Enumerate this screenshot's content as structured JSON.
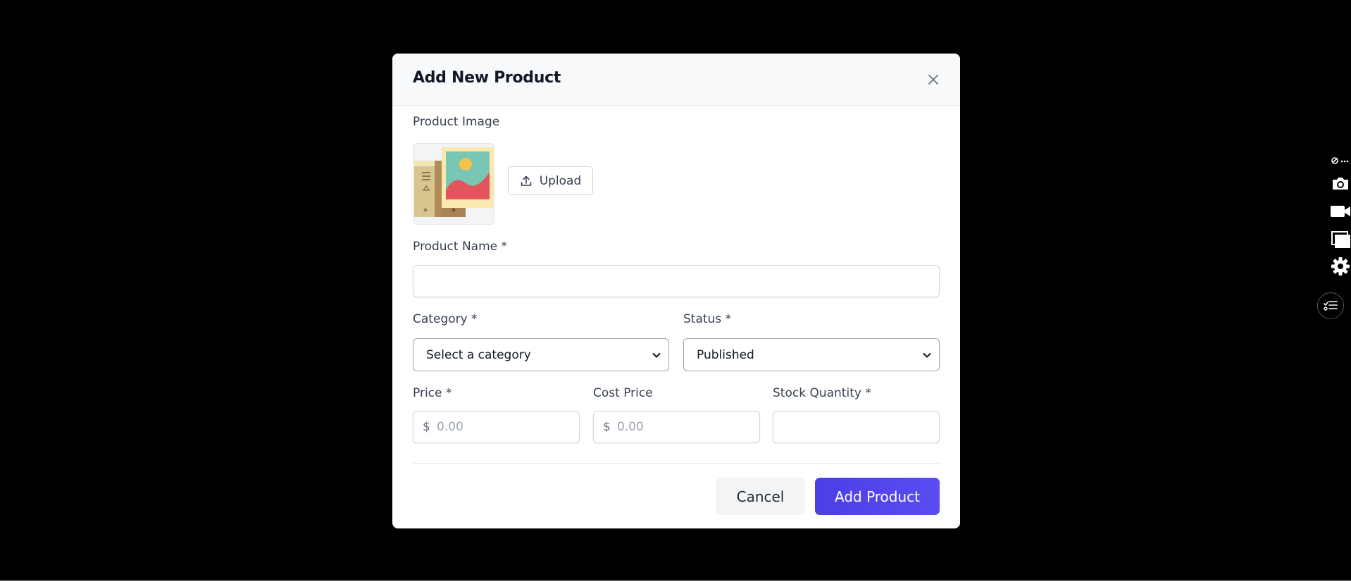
{
  "modal": {
    "title": "Add New Product"
  },
  "product_image": {
    "label": "Product Image",
    "upload_label": "Upload"
  },
  "product_name": {
    "label": "Product Name *",
    "value": ""
  },
  "category": {
    "label": "Category *",
    "selected": "Select a category"
  },
  "status": {
    "label": "Status *",
    "selected": "Published"
  },
  "price": {
    "label": "Price *",
    "currency": "$",
    "placeholder": "0.00"
  },
  "cost_price": {
    "label": "Cost Price",
    "currency": "$",
    "placeholder": "0.00"
  },
  "stock_quantity": {
    "label": "Stock Quantity *",
    "value": ""
  },
  "footer": {
    "cancel_label": "Cancel",
    "submit_label": "Add Product"
  },
  "colors": {
    "primary": "#4f46e5",
    "backdrop": "#000000"
  },
  "side_toolbar": {
    "icons": [
      "link-more-icon",
      "camera-icon",
      "video-icon",
      "windows-icon",
      "gear-icon",
      "checklist-icon"
    ]
  }
}
